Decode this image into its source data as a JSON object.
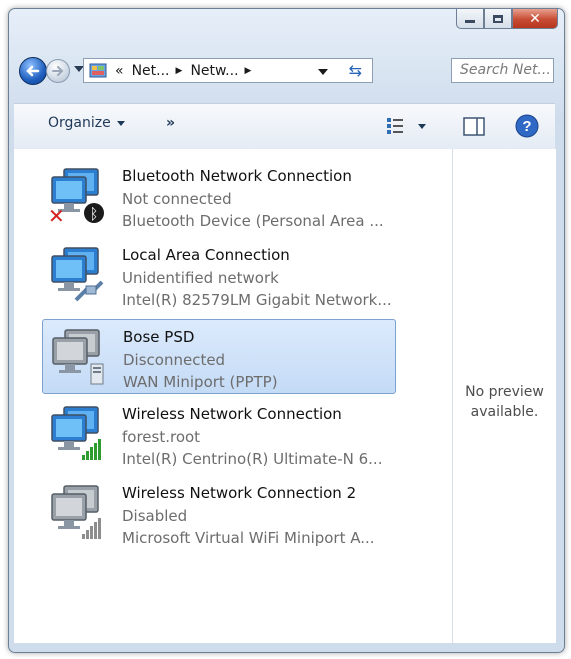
{
  "window": {
    "controls": {
      "minimize_icon": "minimize-icon",
      "maximize_icon": "maximize-icon",
      "close_icon": "close-icon"
    }
  },
  "navigation": {
    "breadcrumbs": [
      "Net...",
      "Netw..."
    ],
    "breadcrumb_prefix": "«",
    "search_placeholder": "Search Net..."
  },
  "toolbar": {
    "organize_label": "Organize",
    "more_label": "»"
  },
  "items": [
    {
      "name": "Bluetooth Network Connection",
      "status": "Not connected",
      "device": "Bluetooth Device (Personal Area ...",
      "icon": "bluetooth-adapter-icon",
      "selected": false
    },
    {
      "name": "Local Area Connection",
      "status": "Unidentified network",
      "device": "Intel(R) 82579LM Gigabit Network...",
      "icon": "ethernet-adapter-icon",
      "selected": false
    },
    {
      "name": "Bose PSD",
      "status": "Disconnected",
      "device": "WAN Miniport (PPTP)",
      "icon": "vpn-adapter-icon",
      "selected": true
    },
    {
      "name": "Wireless Network Connection",
      "status": "forest.root",
      "device": "Intel(R) Centrino(R) Ultimate-N 6...",
      "icon": "wifi-adapter-icon",
      "selected": false
    },
    {
      "name": "Wireless Network Connection 2",
      "status": "Disabled",
      "device": "Microsoft Virtual WiFi Miniport A...",
      "icon": "wifi-disabled-adapter-icon",
      "selected": false
    }
  ],
  "preview": {
    "line1": "No preview",
    "line2": "available."
  },
  "colors": {
    "accent_blue": "#2d6cc9",
    "selection_bg": "#cfe2f8",
    "close_red": "#c74c33"
  }
}
